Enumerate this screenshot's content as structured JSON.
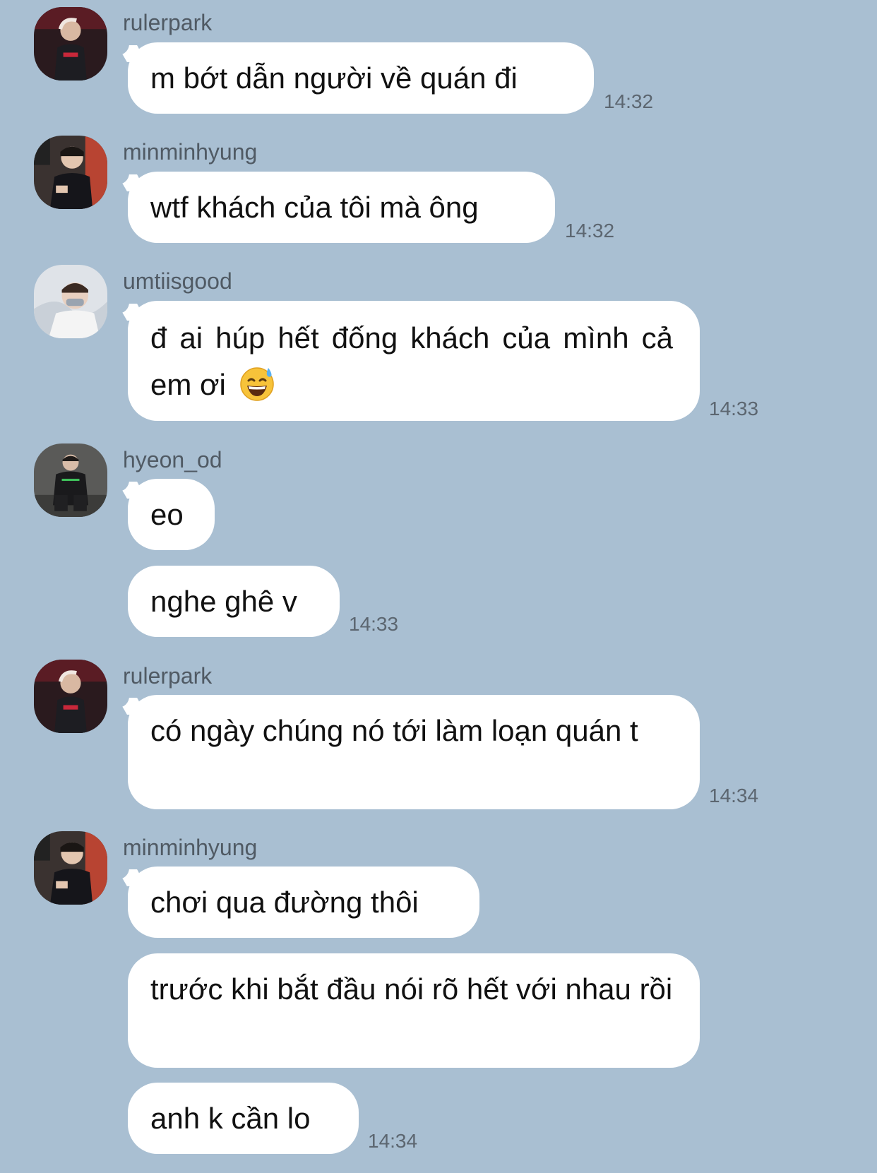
{
  "messages": [
    {
      "sender": "rulerpark",
      "text": "m bớt dẫn người về quán đi",
      "time": "14:32"
    },
    {
      "sender": "minminhyung",
      "text": "wtf khách của tôi mà ông",
      "time": "14:32"
    },
    {
      "sender": "umtiisgood",
      "text": "đ ai húp hết đống khách của mình cả em ơi",
      "emoji": "grinning-sweat-emoji",
      "time": "14:33"
    },
    {
      "sender": "hyeon_od",
      "text": "eo"
    },
    {
      "text": "nghe ghê v",
      "time": "14:33"
    },
    {
      "sender": "rulerpark",
      "text": "có ngày chúng nó tới làm loạn quán t",
      "time": "14:34"
    },
    {
      "sender": "minminhyung",
      "text": "chơi qua đường thôi"
    },
    {
      "text": "trước khi bắt đầu nói rõ hết với nhau rồi"
    },
    {
      "text": "anh k cần lo",
      "time": "14:34"
    }
  ],
  "colors": {
    "background": "#a9bfd2",
    "bubble": "#ffffff",
    "name": "#505a64",
    "time": "#5c6670"
  },
  "icons": [
    "avatar-rulerpark",
    "avatar-minminhyung",
    "avatar-umtiisgood",
    "avatar-hyeon_od",
    "grinning-sweat-emoji"
  ]
}
